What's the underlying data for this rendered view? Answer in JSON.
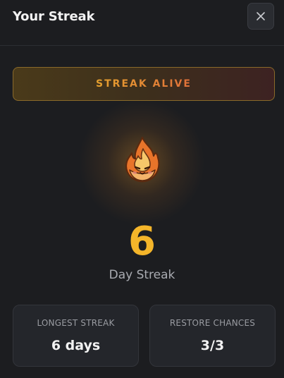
{
  "header": {
    "title": "Your Streak",
    "close_icon": "close-icon"
  },
  "banner": {
    "text": "STREAK ALIVE"
  },
  "streak": {
    "icon": "fire-icon",
    "count": "6",
    "label": "Day Streak"
  },
  "stats": {
    "longest": {
      "label": "LONGEST STREAK",
      "value": "6 days"
    },
    "restore": {
      "label": "RESTORE CHANCES",
      "value": "3/3"
    }
  },
  "colors": {
    "background": "#1c1d20",
    "accent": "#f4b52a",
    "banner_text": "#e49a2a",
    "banner_border": "#8a6a2a"
  }
}
